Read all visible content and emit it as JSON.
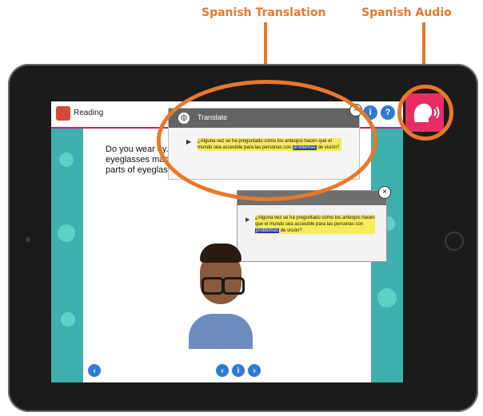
{
  "callouts": {
    "translation_label": "Spanish Translation",
    "audio_label": "Spanish Audio"
  },
  "app": {
    "title": "Reading"
  },
  "reading": {
    "text": "Do you wear ey... how eyeglasses mad... the parts of eyeglasse..."
  },
  "translate_popup": {
    "title": "Translate",
    "text_before": "¿Alguna vez se ha preguntado cómo los anteojos hacen que el mundo sea accesible para las personas con",
    "highlight": "problemas",
    "text_after": "de visión?"
  },
  "secondary_popup": {
    "text_before": "¿Alguna vez se ha preguntado cómo los anteojos hacen que el mundo sea accesible para las personas con",
    "highlight": "problemas",
    "text_after": "de visión?"
  },
  "colors": {
    "accent": "#e8782a",
    "audio_button": "#e72e64",
    "nav_blue": "#2d7bd6",
    "panel_teal": "#3eb0ad",
    "highlight": "#f7eb5b"
  },
  "icons": {
    "app": "reading-book-icon",
    "globe": "globe-icon",
    "audio": "speaking-head-icon",
    "close": "close-icon",
    "prev": "chevron-left-icon",
    "next": "chevron-right-icon",
    "info": "info-icon"
  },
  "nav": {
    "info_glyph": "i",
    "help_glyph": "?",
    "close_glyph": "×"
  }
}
